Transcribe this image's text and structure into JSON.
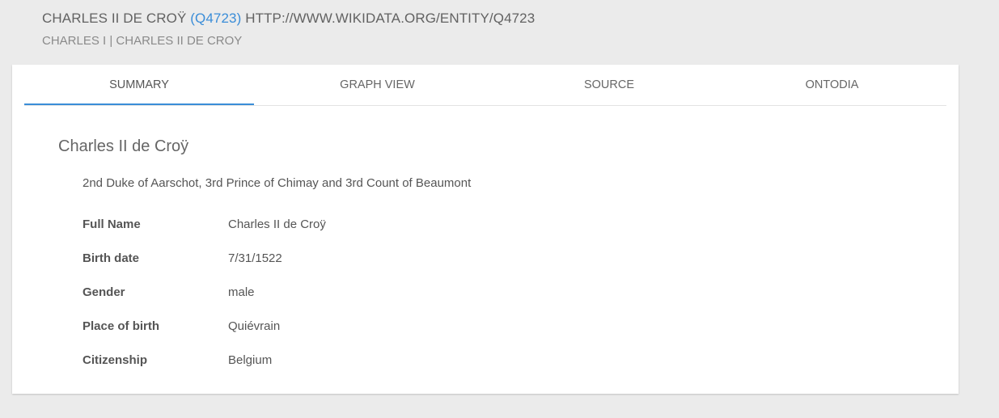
{
  "header": {
    "title": "CHARLES II DE CROŸ",
    "qid": "(Q4723)",
    "uri": "HTTP://WWW.WIKIDATA.ORG/ENTITY/Q4723",
    "alt_labels": "CHARLES I | CHARLES II DE CROY"
  },
  "tabs": [
    {
      "label": "SUMMARY",
      "active": true
    },
    {
      "label": "GRAPH VIEW",
      "active": false
    },
    {
      "label": "SOURCE",
      "active": false
    },
    {
      "label": "ONTODIA",
      "active": false
    }
  ],
  "summary": {
    "name": "Charles II de Croÿ",
    "description": "2nd Duke of Aarschot, 3rd Prince of Chimay and 3rd Count of Beaumont",
    "properties": [
      {
        "label": "Full Name",
        "value": "Charles II de Croÿ"
      },
      {
        "label": "Birth date",
        "value": "7/31/1522"
      },
      {
        "label": "Gender",
        "value": "male"
      },
      {
        "label": "Place of birth",
        "value": "Quiévrain"
      },
      {
        "label": "Citizenship",
        "value": "Belgium"
      }
    ]
  },
  "colors": {
    "accent": "#3a8dd8",
    "background": "#ebebeb",
    "card": "#ffffff"
  }
}
